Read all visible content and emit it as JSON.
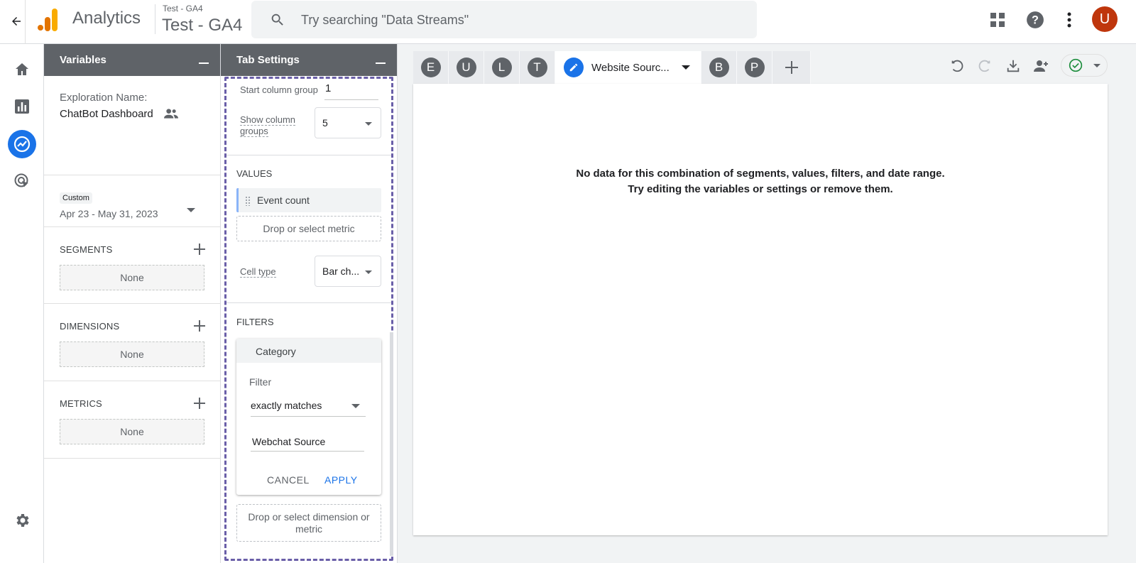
{
  "header": {
    "app_name": "Analytics",
    "account_small": "Test - GA4",
    "account_big": "Test - GA4",
    "search_placeholder": "Try searching \"Data Streams\"",
    "avatar_letter": "U"
  },
  "colors": {
    "accent": "#1a73e8",
    "avatar": "#bf360c",
    "panel_header": "#5f6368",
    "focus_dashed": "#6a5fa8",
    "status_ok": "#1e8e3e"
  },
  "left_nav": {
    "icons": [
      "home-icon",
      "reports-icon",
      "explore-icon",
      "advertising-icon",
      "settings-icon"
    ],
    "active": "explore-icon"
  },
  "variables": {
    "title": "Variables",
    "exploration_label": "Exploration Name:",
    "exploration_name": "ChatBot Dashboard",
    "date_chip": "Custom",
    "date_range": "Apr 23 - May 31, 2023",
    "segments_title": "SEGMENTS",
    "segments_value": "None",
    "dimensions_title": "DIMENSIONS",
    "dimensions_value": "None",
    "metrics_title": "METRICS",
    "metrics_value": "None"
  },
  "tab_settings": {
    "title": "Tab Settings",
    "start_column_label": "Start column group",
    "start_column_value": "1",
    "show_groups_label_1": "Show column",
    "show_groups_label_2": "groups",
    "show_groups_value": "5",
    "values_title": "VALUES",
    "value_metric": "Event count",
    "drop_metric": "Drop or select metric",
    "cell_type_label": "Cell type",
    "cell_type_value": "Bar ch...",
    "filters_title": "FILTERS",
    "filter": {
      "dimension": "Category",
      "label": "Filter",
      "match_type": "exactly matches",
      "value": "Webchat Source",
      "cancel": "CANCEL",
      "apply": "APPLY"
    },
    "drop_dimension_1": "Drop or select dimension or",
    "drop_dimension_2": "metric"
  },
  "tabs": {
    "letters": [
      "E",
      "U",
      "L",
      "T"
    ],
    "active_title": "Website Sourc...",
    "after_letters": [
      "B",
      "P"
    ]
  },
  "canvas": {
    "message_line1": "No data for this combination of segments, values, filters, and date range.",
    "message_line2": "Try editing the variables or settings or remove them."
  }
}
